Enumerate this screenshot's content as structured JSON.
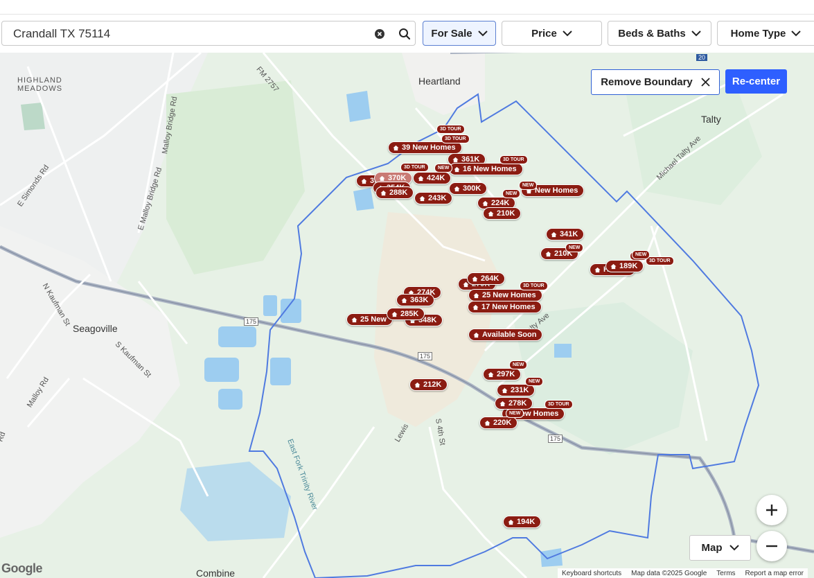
{
  "search": {
    "value": "Crandall TX 75114"
  },
  "filters": [
    {
      "label": "For Sale"
    },
    {
      "label": "Price"
    },
    {
      "label": "Beds & Baths"
    },
    {
      "label": "Home Type"
    }
  ],
  "map_controls": {
    "remove_boundary": "Remove Boundary",
    "recenter": "Re-center",
    "map_type": "Map"
  },
  "attribution": {
    "shortcuts": "Keyboard shortcuts",
    "data": "Map data ©2025 Google",
    "terms": "Terms",
    "report": "Report a map error",
    "logo": "Google"
  },
  "places": {
    "heartland": "Heartland",
    "highland": "HIGHLAND",
    "meadows": "MEADOWS",
    "talty": "Talty",
    "seagoville": "Seagoville",
    "combine": "Combine",
    "fm2757": "FM 2757",
    "malloy_bridge_rd": "Malloy Bridge Rd",
    "e_malloy_bridge_rd": "E Malloy Bridge Rd",
    "e_simonds_rd": "E Simonds Rd",
    "n_kaufman_st": "N Kaufman St",
    "s_kaufman_st": "S Kaufman St",
    "malloy_rd": "Malloy Rd",
    "michael_talty_ave": "Michael Talty Ave",
    "talty_ave": "Talty Ave",
    "lewis": "Lewis",
    "s_4th_st": "S 4th St",
    "east_fork": "East Fork Trinity River",
    "hwy175a": "175",
    "hwy175b": "175",
    "hwy175c": "175",
    "i20": "20",
    "rd": "Rd"
  },
  "listings": [
    {
      "label": "39 New Homes"
    },
    {
      "label": "361K"
    },
    {
      "label": "16 New Homes"
    },
    {
      "label": "370K"
    },
    {
      "label": "424K"
    },
    {
      "label": "354K"
    },
    {
      "label": "288K"
    },
    {
      "label": "300K"
    },
    {
      "label": "243K"
    },
    {
      "label": "333K"
    },
    {
      "label": "New Homes"
    },
    {
      "label": "224K"
    },
    {
      "label": "210K"
    },
    {
      "label": "341K"
    },
    {
      "label": "210K"
    },
    {
      "label": "189K"
    },
    {
      "label": "Homes"
    },
    {
      "label": "274K"
    },
    {
      "label": "363K"
    },
    {
      "label": "264K"
    },
    {
      "label": "279K"
    },
    {
      "label": "25 New Homes"
    },
    {
      "label": "17 New Homes"
    },
    {
      "label": "25 New"
    },
    {
      "label": "285K"
    },
    {
      "label": "348K"
    },
    {
      "label": "Available Soon"
    },
    {
      "label": "297K"
    },
    {
      "label": "231K"
    },
    {
      "label": "278K"
    },
    {
      "label": "New Homes"
    },
    {
      "label": "220K"
    },
    {
      "label": "212K"
    },
    {
      "label": "194K"
    }
  ],
  "badges": [
    {
      "label": "3D TOUR"
    },
    {
      "label": "3D TOUR"
    },
    {
      "label": "3D TOUR"
    },
    {
      "label": "3D TOUR"
    },
    {
      "label": "NEW"
    },
    {
      "label": "NEW"
    },
    {
      "label": "NEW"
    },
    {
      "label": "NEW"
    },
    {
      "label": "3D TOUR"
    },
    {
      "label": "NEW"
    },
    {
      "label": "3D TOUR"
    },
    {
      "label": "NEW"
    },
    {
      "label": "NEW"
    },
    {
      "label": "NEW"
    },
    {
      "label": "3D TOUR"
    },
    {
      "label": "NEW"
    }
  ]
}
